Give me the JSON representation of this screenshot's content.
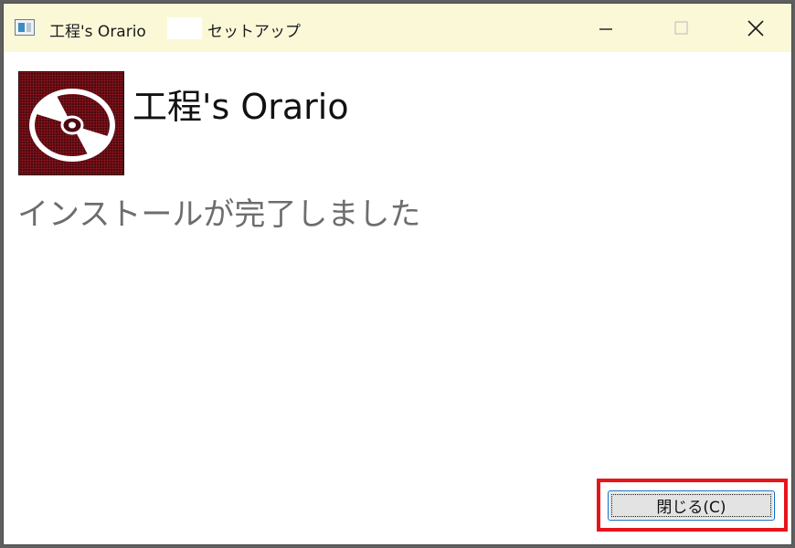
{
  "window": {
    "title": "工程's Orario",
    "title_suffix": "セットアップ",
    "caption": {
      "minimize_icon": "minimize-icon",
      "maximize_icon": "maximize-icon",
      "close_icon": "close-icon"
    }
  },
  "header": {
    "icon": "disc-icon",
    "product_name": "工程's Orario"
  },
  "status": {
    "message": "インストールが完了しました"
  },
  "footer": {
    "close_button_label": "閉じる(C)"
  },
  "colors": {
    "titlebar": "#fbf8d8",
    "highlight": "#e8141c",
    "status_text": "#6d6d6d",
    "icon_background": "#4a0a10"
  }
}
